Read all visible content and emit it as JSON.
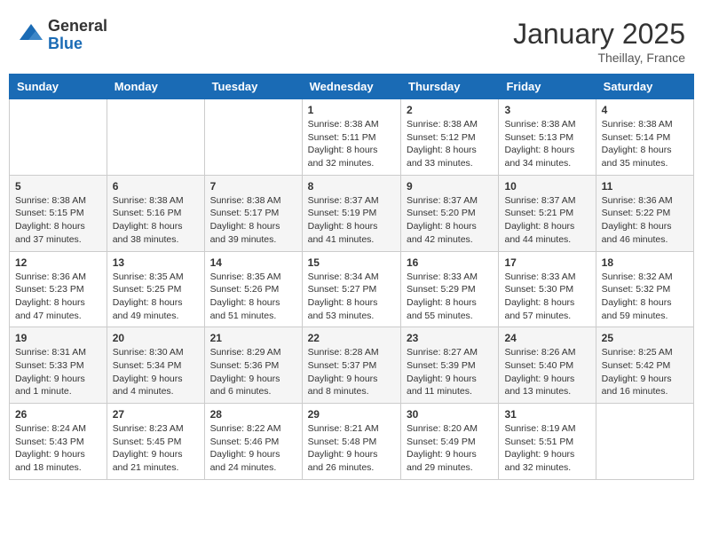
{
  "header": {
    "logo_general": "General",
    "logo_blue": "Blue",
    "month_year": "January 2025",
    "location": "Theillay, France"
  },
  "days_of_week": [
    "Sunday",
    "Monday",
    "Tuesday",
    "Wednesday",
    "Thursday",
    "Friday",
    "Saturday"
  ],
  "weeks": [
    [
      {
        "day": "",
        "info": ""
      },
      {
        "day": "",
        "info": ""
      },
      {
        "day": "",
        "info": ""
      },
      {
        "day": "1",
        "info": "Sunrise: 8:38 AM\nSunset: 5:11 PM\nDaylight: 8 hours and 32 minutes."
      },
      {
        "day": "2",
        "info": "Sunrise: 8:38 AM\nSunset: 5:12 PM\nDaylight: 8 hours and 33 minutes."
      },
      {
        "day": "3",
        "info": "Sunrise: 8:38 AM\nSunset: 5:13 PM\nDaylight: 8 hours and 34 minutes."
      },
      {
        "day": "4",
        "info": "Sunrise: 8:38 AM\nSunset: 5:14 PM\nDaylight: 8 hours and 35 minutes."
      }
    ],
    [
      {
        "day": "5",
        "info": "Sunrise: 8:38 AM\nSunset: 5:15 PM\nDaylight: 8 hours and 37 minutes."
      },
      {
        "day": "6",
        "info": "Sunrise: 8:38 AM\nSunset: 5:16 PM\nDaylight: 8 hours and 38 minutes."
      },
      {
        "day": "7",
        "info": "Sunrise: 8:38 AM\nSunset: 5:17 PM\nDaylight: 8 hours and 39 minutes."
      },
      {
        "day": "8",
        "info": "Sunrise: 8:37 AM\nSunset: 5:19 PM\nDaylight: 8 hours and 41 minutes."
      },
      {
        "day": "9",
        "info": "Sunrise: 8:37 AM\nSunset: 5:20 PM\nDaylight: 8 hours and 42 minutes."
      },
      {
        "day": "10",
        "info": "Sunrise: 8:37 AM\nSunset: 5:21 PM\nDaylight: 8 hours and 44 minutes."
      },
      {
        "day": "11",
        "info": "Sunrise: 8:36 AM\nSunset: 5:22 PM\nDaylight: 8 hours and 46 minutes."
      }
    ],
    [
      {
        "day": "12",
        "info": "Sunrise: 8:36 AM\nSunset: 5:23 PM\nDaylight: 8 hours and 47 minutes."
      },
      {
        "day": "13",
        "info": "Sunrise: 8:35 AM\nSunset: 5:25 PM\nDaylight: 8 hours and 49 minutes."
      },
      {
        "day": "14",
        "info": "Sunrise: 8:35 AM\nSunset: 5:26 PM\nDaylight: 8 hours and 51 minutes."
      },
      {
        "day": "15",
        "info": "Sunrise: 8:34 AM\nSunset: 5:27 PM\nDaylight: 8 hours and 53 minutes."
      },
      {
        "day": "16",
        "info": "Sunrise: 8:33 AM\nSunset: 5:29 PM\nDaylight: 8 hours and 55 minutes."
      },
      {
        "day": "17",
        "info": "Sunrise: 8:33 AM\nSunset: 5:30 PM\nDaylight: 8 hours and 57 minutes."
      },
      {
        "day": "18",
        "info": "Sunrise: 8:32 AM\nSunset: 5:32 PM\nDaylight: 8 hours and 59 minutes."
      }
    ],
    [
      {
        "day": "19",
        "info": "Sunrise: 8:31 AM\nSunset: 5:33 PM\nDaylight: 9 hours and 1 minute."
      },
      {
        "day": "20",
        "info": "Sunrise: 8:30 AM\nSunset: 5:34 PM\nDaylight: 9 hours and 4 minutes."
      },
      {
        "day": "21",
        "info": "Sunrise: 8:29 AM\nSunset: 5:36 PM\nDaylight: 9 hours and 6 minutes."
      },
      {
        "day": "22",
        "info": "Sunrise: 8:28 AM\nSunset: 5:37 PM\nDaylight: 9 hours and 8 minutes."
      },
      {
        "day": "23",
        "info": "Sunrise: 8:27 AM\nSunset: 5:39 PM\nDaylight: 9 hours and 11 minutes."
      },
      {
        "day": "24",
        "info": "Sunrise: 8:26 AM\nSunset: 5:40 PM\nDaylight: 9 hours and 13 minutes."
      },
      {
        "day": "25",
        "info": "Sunrise: 8:25 AM\nSunset: 5:42 PM\nDaylight: 9 hours and 16 minutes."
      }
    ],
    [
      {
        "day": "26",
        "info": "Sunrise: 8:24 AM\nSunset: 5:43 PM\nDaylight: 9 hours and 18 minutes."
      },
      {
        "day": "27",
        "info": "Sunrise: 8:23 AM\nSunset: 5:45 PM\nDaylight: 9 hours and 21 minutes."
      },
      {
        "day": "28",
        "info": "Sunrise: 8:22 AM\nSunset: 5:46 PM\nDaylight: 9 hours and 24 minutes."
      },
      {
        "day": "29",
        "info": "Sunrise: 8:21 AM\nSunset: 5:48 PM\nDaylight: 9 hours and 26 minutes."
      },
      {
        "day": "30",
        "info": "Sunrise: 8:20 AM\nSunset: 5:49 PM\nDaylight: 9 hours and 29 minutes."
      },
      {
        "day": "31",
        "info": "Sunrise: 8:19 AM\nSunset: 5:51 PM\nDaylight: 9 hours and 32 minutes."
      },
      {
        "day": "",
        "info": ""
      }
    ]
  ]
}
